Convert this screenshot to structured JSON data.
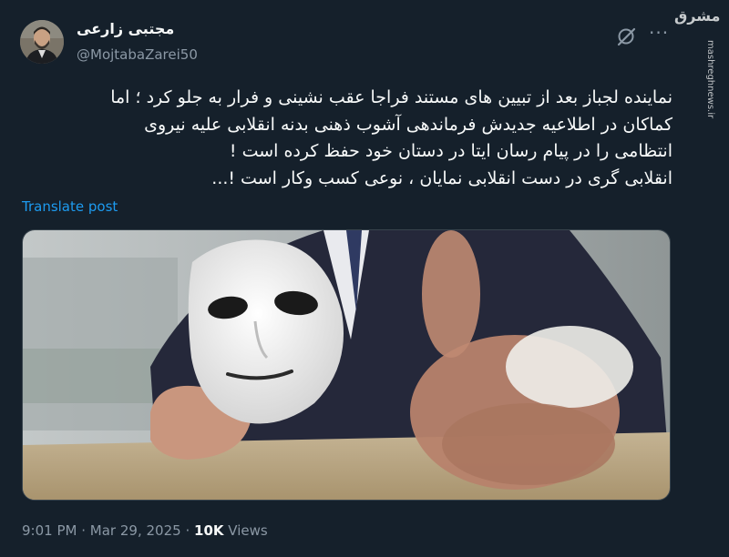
{
  "author": {
    "display_name": "مجتبی زارعی",
    "handle": "@MojtabaZarei50"
  },
  "tweet": {
    "lines": [
      "نماینده لجباز بعد از تبیین های مستند فراجا عقب نشینی و فرار به جلو کرد ؛ اما",
      "کماکان در اطلاعیه جدیدش فرماندهی آشوب ذهنی بدنه انقلابی  علیه نیروی",
      "انتظامی را در پیام رسان ایتا در دستان خود حفظ کرده است !",
      "انقلابی گری در دست انقلابی نمایان ، نوعی کسب وکار است !..."
    ],
    "translate_label": "Translate post"
  },
  "meta": {
    "time": "9:01 PM",
    "separator": "·",
    "date": "Mar 29, 2025",
    "views_count": "10K",
    "views_label": "Views"
  },
  "watermark": {
    "logo": "مشرق",
    "url": "mashreghnews.ir"
  },
  "icons": {
    "grok": "grok-icon",
    "more": "more-icon"
  },
  "colors": {
    "background": "#15202b",
    "link": "#1d9bf0",
    "secondary_text": "#8b98a5"
  }
}
